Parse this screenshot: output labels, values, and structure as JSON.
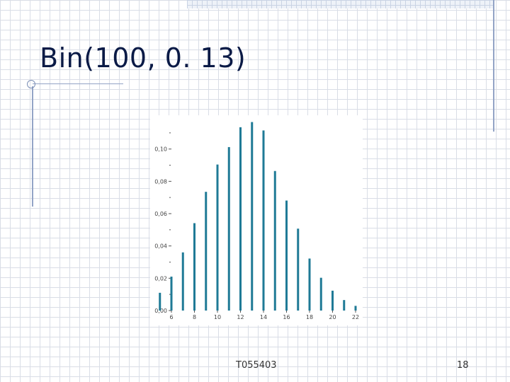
{
  "slide": {
    "title": "Bin(100, 0. 13)",
    "footer_text": "T055403",
    "page_number": "18"
  },
  "colors": {
    "bar": "#1f7a96",
    "axis": "#555555",
    "title": "#0a1a46",
    "decoration": "#93a4c6"
  },
  "chart_data": {
    "type": "bar",
    "title": "",
    "xlabel": "",
    "ylabel": "",
    "x": [
      5,
      6,
      7,
      8,
      9,
      10,
      11,
      12,
      13,
      14,
      15,
      16,
      17,
      18,
      19,
      20,
      21,
      22
    ],
    "values": [
      0.011,
      0.021,
      0.036,
      0.0541,
      0.0735,
      0.0904,
      0.1012,
      0.1135,
      0.1167,
      0.1115,
      0.0864,
      0.0681,
      0.0507,
      0.0322,
      0.0203,
      0.0123,
      0.0065,
      0.0029
    ],
    "xlim": [
      6,
      22
    ],
    "ylim": [
      0,
      0.12
    ],
    "x_ticks": [
      6,
      8,
      10,
      12,
      14,
      16,
      18,
      20,
      22
    ],
    "y_ticks": [
      0,
      0.02,
      0.04,
      0.06,
      0.08,
      0.1
    ],
    "y_tick_labels": [
      "0,00",
      "0,02",
      "0,04",
      "0,06",
      "0,08",
      "0,10"
    ],
    "y_minor_ticks": [
      0.01,
      0.03,
      0.05,
      0.07,
      0.09,
      0.11
    ],
    "grid": false,
    "legend": "none"
  }
}
